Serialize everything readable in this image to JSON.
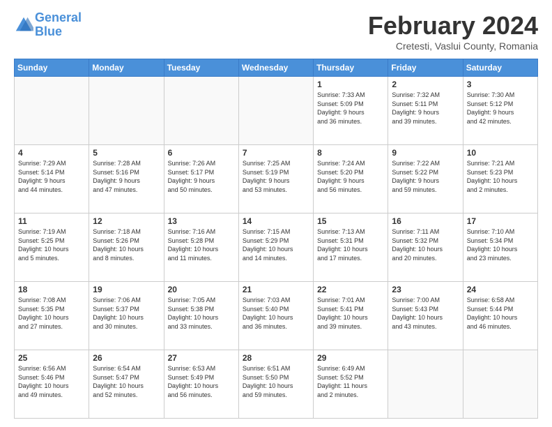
{
  "header": {
    "logo_line1": "General",
    "logo_line2": "Blue",
    "month_title": "February 2024",
    "location": "Cretesti, Vaslui County, Romania"
  },
  "weekdays": [
    "Sunday",
    "Monday",
    "Tuesday",
    "Wednesday",
    "Thursday",
    "Friday",
    "Saturday"
  ],
  "weeks": [
    [
      {
        "day": "",
        "info": ""
      },
      {
        "day": "",
        "info": ""
      },
      {
        "day": "",
        "info": ""
      },
      {
        "day": "",
        "info": ""
      },
      {
        "day": "1",
        "info": "Sunrise: 7:33 AM\nSunset: 5:09 PM\nDaylight: 9 hours\nand 36 minutes."
      },
      {
        "day": "2",
        "info": "Sunrise: 7:32 AM\nSunset: 5:11 PM\nDaylight: 9 hours\nand 39 minutes."
      },
      {
        "day": "3",
        "info": "Sunrise: 7:30 AM\nSunset: 5:12 PM\nDaylight: 9 hours\nand 42 minutes."
      }
    ],
    [
      {
        "day": "4",
        "info": "Sunrise: 7:29 AM\nSunset: 5:14 PM\nDaylight: 9 hours\nand 44 minutes."
      },
      {
        "day": "5",
        "info": "Sunrise: 7:28 AM\nSunset: 5:16 PM\nDaylight: 9 hours\nand 47 minutes."
      },
      {
        "day": "6",
        "info": "Sunrise: 7:26 AM\nSunset: 5:17 PM\nDaylight: 9 hours\nand 50 minutes."
      },
      {
        "day": "7",
        "info": "Sunrise: 7:25 AM\nSunset: 5:19 PM\nDaylight: 9 hours\nand 53 minutes."
      },
      {
        "day": "8",
        "info": "Sunrise: 7:24 AM\nSunset: 5:20 PM\nDaylight: 9 hours\nand 56 minutes."
      },
      {
        "day": "9",
        "info": "Sunrise: 7:22 AM\nSunset: 5:22 PM\nDaylight: 9 hours\nand 59 minutes."
      },
      {
        "day": "10",
        "info": "Sunrise: 7:21 AM\nSunset: 5:23 PM\nDaylight: 10 hours\nand 2 minutes."
      }
    ],
    [
      {
        "day": "11",
        "info": "Sunrise: 7:19 AM\nSunset: 5:25 PM\nDaylight: 10 hours\nand 5 minutes."
      },
      {
        "day": "12",
        "info": "Sunrise: 7:18 AM\nSunset: 5:26 PM\nDaylight: 10 hours\nand 8 minutes."
      },
      {
        "day": "13",
        "info": "Sunrise: 7:16 AM\nSunset: 5:28 PM\nDaylight: 10 hours\nand 11 minutes."
      },
      {
        "day": "14",
        "info": "Sunrise: 7:15 AM\nSunset: 5:29 PM\nDaylight: 10 hours\nand 14 minutes."
      },
      {
        "day": "15",
        "info": "Sunrise: 7:13 AM\nSunset: 5:31 PM\nDaylight: 10 hours\nand 17 minutes."
      },
      {
        "day": "16",
        "info": "Sunrise: 7:11 AM\nSunset: 5:32 PM\nDaylight: 10 hours\nand 20 minutes."
      },
      {
        "day": "17",
        "info": "Sunrise: 7:10 AM\nSunset: 5:34 PM\nDaylight: 10 hours\nand 23 minutes."
      }
    ],
    [
      {
        "day": "18",
        "info": "Sunrise: 7:08 AM\nSunset: 5:35 PM\nDaylight: 10 hours\nand 27 minutes."
      },
      {
        "day": "19",
        "info": "Sunrise: 7:06 AM\nSunset: 5:37 PM\nDaylight: 10 hours\nand 30 minutes."
      },
      {
        "day": "20",
        "info": "Sunrise: 7:05 AM\nSunset: 5:38 PM\nDaylight: 10 hours\nand 33 minutes."
      },
      {
        "day": "21",
        "info": "Sunrise: 7:03 AM\nSunset: 5:40 PM\nDaylight: 10 hours\nand 36 minutes."
      },
      {
        "day": "22",
        "info": "Sunrise: 7:01 AM\nSunset: 5:41 PM\nDaylight: 10 hours\nand 39 minutes."
      },
      {
        "day": "23",
        "info": "Sunrise: 7:00 AM\nSunset: 5:43 PM\nDaylight: 10 hours\nand 43 minutes."
      },
      {
        "day": "24",
        "info": "Sunrise: 6:58 AM\nSunset: 5:44 PM\nDaylight: 10 hours\nand 46 minutes."
      }
    ],
    [
      {
        "day": "25",
        "info": "Sunrise: 6:56 AM\nSunset: 5:46 PM\nDaylight: 10 hours\nand 49 minutes."
      },
      {
        "day": "26",
        "info": "Sunrise: 6:54 AM\nSunset: 5:47 PM\nDaylight: 10 hours\nand 52 minutes."
      },
      {
        "day": "27",
        "info": "Sunrise: 6:53 AM\nSunset: 5:49 PM\nDaylight: 10 hours\nand 56 minutes."
      },
      {
        "day": "28",
        "info": "Sunrise: 6:51 AM\nSunset: 5:50 PM\nDaylight: 10 hours\nand 59 minutes."
      },
      {
        "day": "29",
        "info": "Sunrise: 6:49 AM\nSunset: 5:52 PM\nDaylight: 11 hours\nand 2 minutes."
      },
      {
        "day": "",
        "info": ""
      },
      {
        "day": "",
        "info": ""
      }
    ]
  ]
}
